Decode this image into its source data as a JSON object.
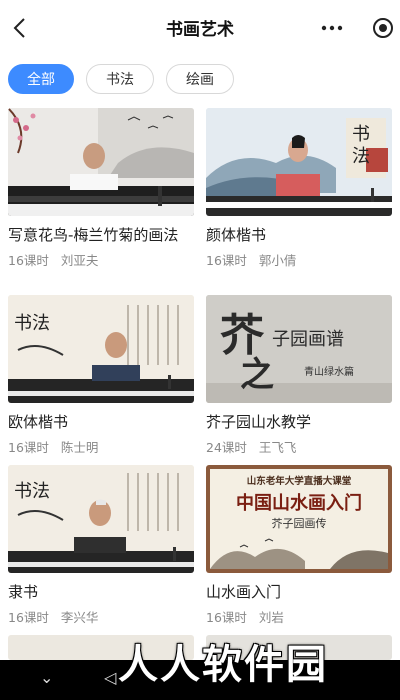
{
  "header": {
    "title": "书画艺术"
  },
  "tabs": [
    {
      "label": "全部",
      "active": true
    },
    {
      "label": "书法",
      "active": false
    },
    {
      "label": "绘画",
      "active": false
    }
  ],
  "courses": [
    {
      "title": "写意花鸟-梅兰竹菊的画法",
      "lessons": "16课时",
      "teacher": "刘亚夫"
    },
    {
      "title": "颜体楷书",
      "lessons": "16课时",
      "teacher": "郭小倩"
    },
    {
      "title": "欧体楷书",
      "lessons": "16课时",
      "teacher": "陈士明"
    },
    {
      "title": "芥子园山水教学",
      "lessons": "24课时",
      "teacher": "王飞飞"
    },
    {
      "title": "隶书",
      "lessons": "16课时",
      "teacher": "李兴华"
    },
    {
      "title": "山水画入门",
      "lessons": "16课时",
      "teacher": "刘岩"
    }
  ],
  "thumbs": {
    "calligraphy_mark_1": "书法",
    "calligraphy_mark_2": "书法",
    "calligraphy_mark_3": "书法",
    "jiezi_big": "芥",
    "jiezi_sub": "子园画谱",
    "jiezi_zhi": "之",
    "jiezi_tag": "青山绿水篇",
    "landscape_banner": "山东老年大学直播大课堂",
    "landscape_title": "中国山水画入门",
    "landscape_sub": "芥子园画传"
  },
  "watermark": "人人软件园",
  "colors": {
    "accent": "#3d8bff",
    "text": "#222222",
    "meta": "#888888"
  }
}
